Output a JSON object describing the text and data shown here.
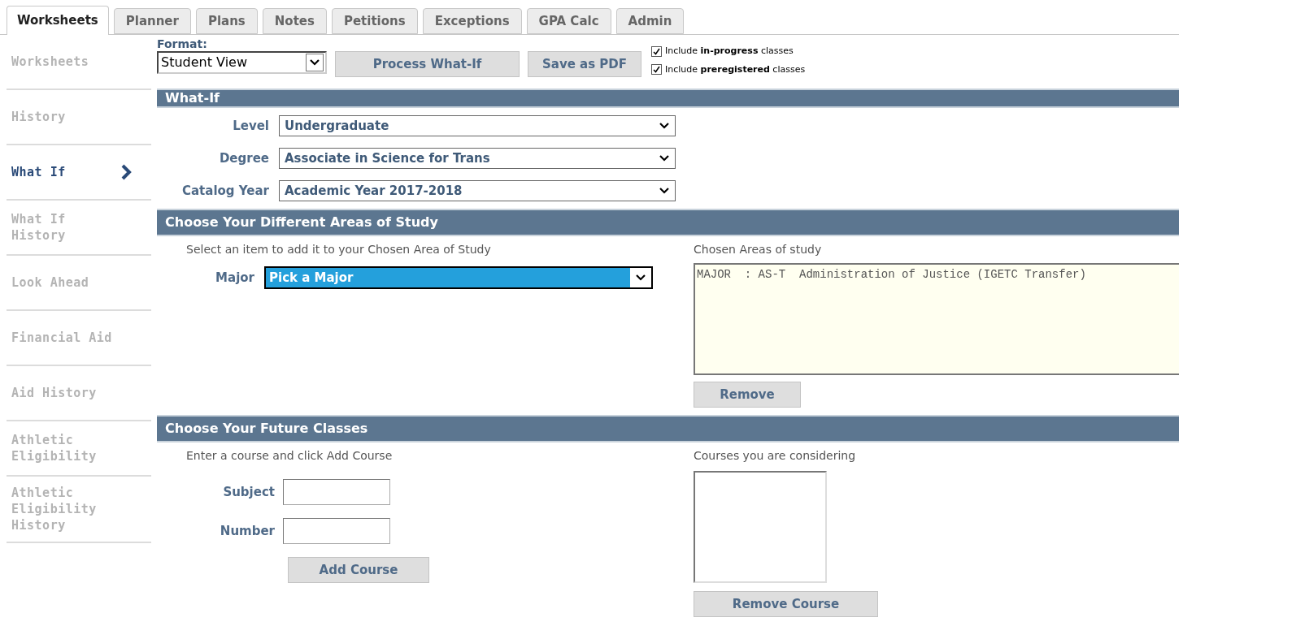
{
  "tabs": [
    {
      "label": "Worksheets",
      "selected": true
    },
    {
      "label": "Planner",
      "selected": false
    },
    {
      "label": "Plans",
      "selected": false
    },
    {
      "label": "Notes",
      "selected": false
    },
    {
      "label": "Petitions",
      "selected": false
    },
    {
      "label": "Exceptions",
      "selected": false
    },
    {
      "label": "GPA Calc",
      "selected": false
    },
    {
      "label": "Admin",
      "selected": false
    }
  ],
  "sidebar": {
    "items": [
      {
        "label": "Worksheets",
        "selected": false
      },
      {
        "label": "History",
        "selected": false
      },
      {
        "label": "What If",
        "selected": true
      },
      {
        "label": "What If History",
        "selected": false
      },
      {
        "label": "Look Ahead",
        "selected": false
      },
      {
        "label": "Financial Aid",
        "selected": false
      },
      {
        "label": "Aid History",
        "selected": false
      },
      {
        "label": "Athletic Eligibility",
        "selected": false
      },
      {
        "label": "Athletic Eligibility History",
        "selected": false
      }
    ]
  },
  "toolbar": {
    "format_label": "Format:",
    "format_value": "Student View",
    "buttons": [
      "Process What-If",
      "Save as PDF"
    ],
    "options": [
      {
        "label": "Include **in-progress** classes",
        "checked": true
      },
      {
        "label": "Include **preregistered** classes",
        "checked": true
      }
    ]
  },
  "what_if": {
    "title": "What-If",
    "fields": [
      {
        "label": "Level",
        "value": "Undergraduate"
      },
      {
        "label": "Degree",
        "value": "Associate in Science for Trans"
      },
      {
        "label": "Catalog Year",
        "value": "Academic Year 2017-2018"
      }
    ]
  },
  "areas": {
    "title": "Choose Your Different Areas of Study",
    "hint": "Select an item to add it to your Chosen Area of Study",
    "major_label": "Major",
    "major_value": "Pick a Major",
    "chosen_label": "Chosen Areas of study",
    "chosen_items": [
      "MAJOR  : AS-T  Administration of Justice (IGETC Transfer)"
    ],
    "remove_button": "Remove"
  },
  "classes": {
    "title": "Choose Your Future Classes",
    "hint": "Enter a course and click Add Course",
    "fields": [
      {
        "label": "Subject"
      },
      {
        "label": "Number"
      }
    ],
    "add_button": "Add Course",
    "considering_label": "Courses you are considering",
    "remove_button": "Remove Course"
  }
}
